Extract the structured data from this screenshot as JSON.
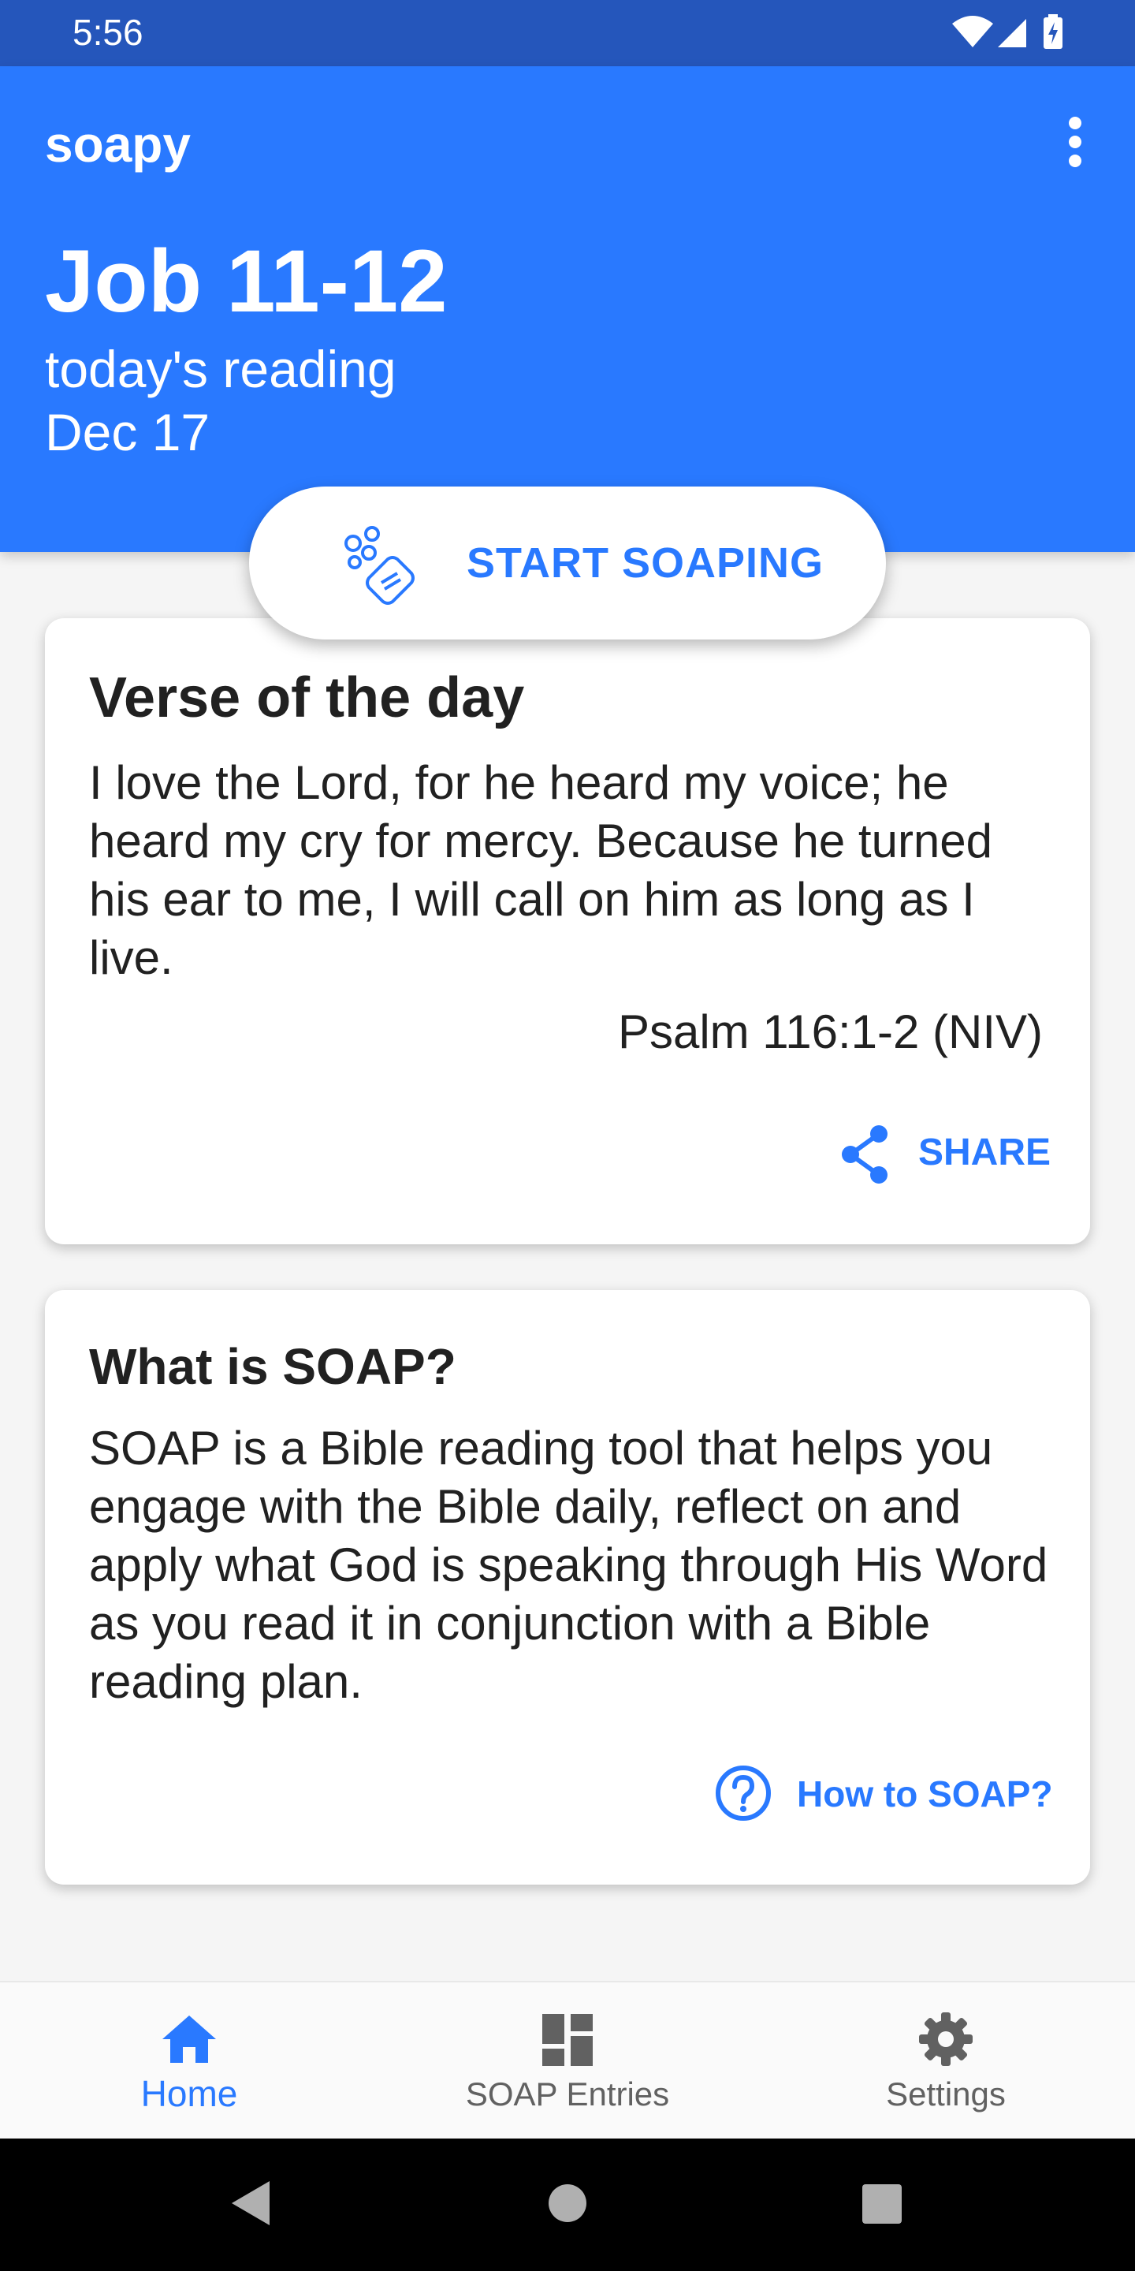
{
  "status_bar": {
    "time": "5:56"
  },
  "header": {
    "app_title": "soapy",
    "reading_title": "Job 11-12",
    "reading_subtitle": "today's reading",
    "reading_date": "Dec 17"
  },
  "start_button": {
    "label": "START SOAPING",
    "icon": "soap-bubbles-icon"
  },
  "verse_card": {
    "title": "Verse of the day",
    "text": "I love the Lord, for he heard my voice; he heard my cry for mercy. Because he turned his ear to me, I will call on him as long as I live.",
    "reference": "Psalm 116:1-2 (NIV)",
    "share_label": "SHARE"
  },
  "soap_card": {
    "title": "What is SOAP?",
    "text": "SOAP is a Bible reading tool that helps you engage with the Bible daily, reflect on and apply what God is speaking through His Word as you read it in conjunction with a Bible reading plan.",
    "help_label": "How to SOAP?"
  },
  "bottom_nav": {
    "items": [
      {
        "label": "Home",
        "icon": "home-icon",
        "active": true
      },
      {
        "label": "SOAP Entries",
        "icon": "dashboard-icon",
        "active": false
      },
      {
        "label": "Settings",
        "icon": "gear-icon",
        "active": false
      }
    ]
  },
  "colors": {
    "primary": "#2979ff",
    "status_bar": "#2556bb",
    "inactive": "#616161",
    "background": "#f5f5f5"
  }
}
